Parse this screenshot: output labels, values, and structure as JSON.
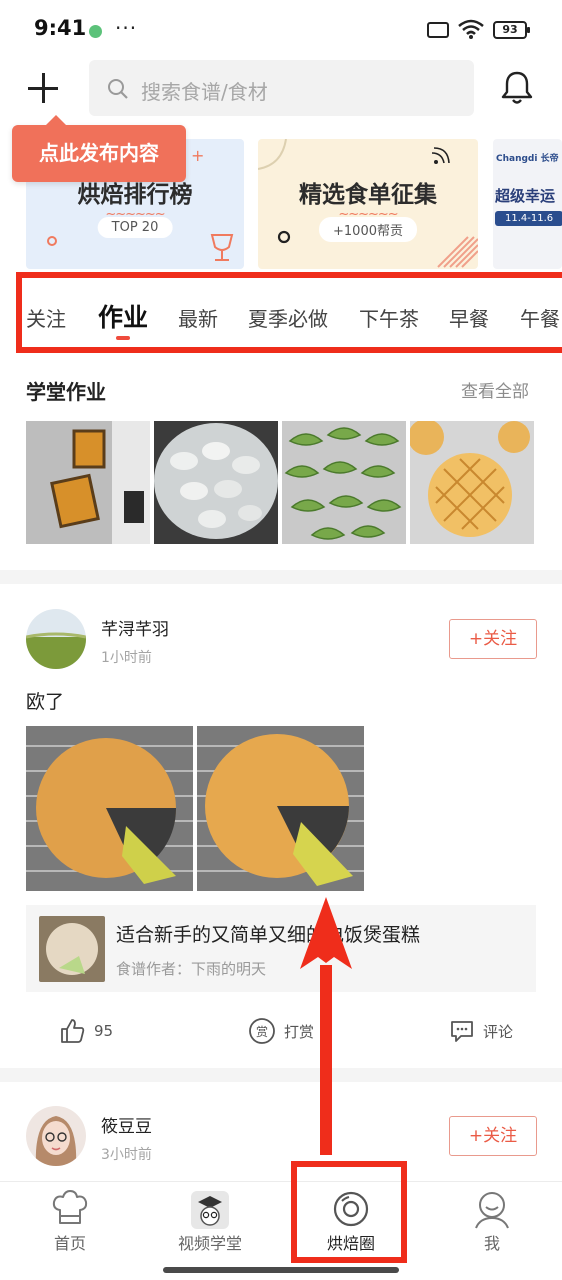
{
  "status_bar": {
    "time": "9:41",
    "more": "···",
    "battery": "93"
  },
  "header": {
    "search_placeholder": "搜索食谱/食材"
  },
  "tooltip": "点此发布内容",
  "banners": [
    {
      "title": "烘焙排行榜",
      "pill": "TOP 20"
    },
    {
      "title": "精选食单征集",
      "pill": "+1000帮贡"
    },
    {
      "brand": "Changdi 长帝",
      "title": "超级幸运",
      "date": "11.4-11.6"
    }
  ],
  "tabs": [
    "关注",
    "作业",
    "最新",
    "夏季必做",
    "下午茶",
    "早餐",
    "午餐"
  ],
  "active_tab": "作业",
  "homework": {
    "title": "学堂作业",
    "more": "查看全部"
  },
  "post1": {
    "user": "芊浔芊羽",
    "time": "1小时前",
    "follow": "+关注",
    "caption": "欧了",
    "recipe_title": "适合新手的又简单又细的电饭煲蛋糕",
    "recipe_author": "食谱作者：下雨的明天",
    "like_count": "95",
    "tip_label": "打赏",
    "comment_label": "评论"
  },
  "post2": {
    "user": "筱豆豆",
    "time": "3小时前",
    "follow": "+关注"
  },
  "bottom_nav": [
    "首页",
    "视频学堂",
    "烘焙圈",
    "我"
  ],
  "colors": {
    "accent": "#ef4b3c",
    "highlight": "#ef2d1b",
    "tooltip": "#f0715a"
  }
}
